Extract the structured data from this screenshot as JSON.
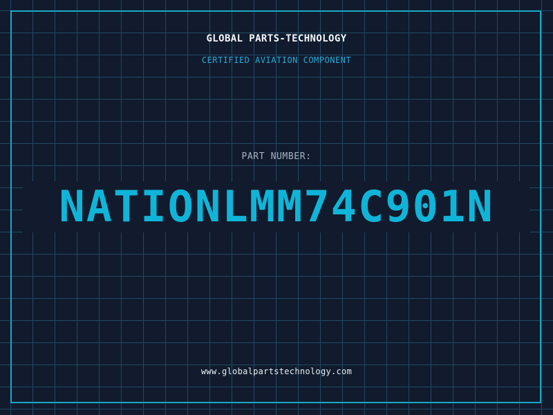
{
  "header": {
    "company": "GLOBAL PARTS-TECHNOLOGY",
    "subtitle": "CERTIFIED AVIATION COMPONENT"
  },
  "part": {
    "label": "PART NUMBER:",
    "number": "NATIONLMM74C901N"
  },
  "footer": {
    "url": "www.globalpartstechnology.com"
  },
  "colors": {
    "background": "#111b2d",
    "grid": "#1f4a63",
    "accent": "#0fb5d8",
    "frame": "#19a9c9"
  }
}
